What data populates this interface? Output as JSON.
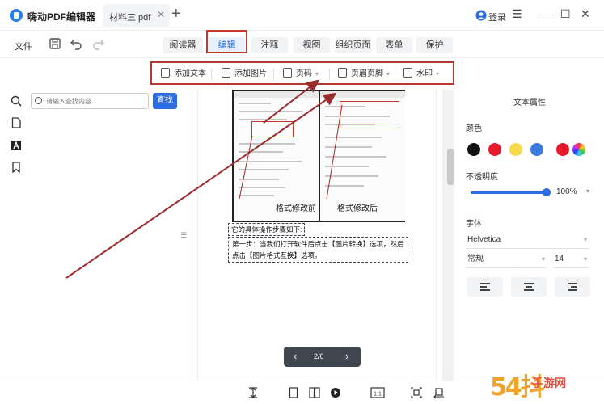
{
  "app": {
    "title": "嗨动PDF编辑器"
  },
  "document_tab": {
    "name": "材料三.pdf",
    "close": "✕",
    "new_tab": "+"
  },
  "account": {
    "login": "登录"
  },
  "window_controls": {
    "menu": "☰",
    "minimize": "—",
    "maximize": "☐",
    "close": "✕"
  },
  "menubar": {
    "file": "文件",
    "tabs": [
      {
        "label": "阅读器"
      },
      {
        "label": "编辑"
      },
      {
        "label": "注释"
      },
      {
        "label": "视图"
      },
      {
        "label": "组织页面"
      },
      {
        "label": "表单"
      },
      {
        "label": "保护"
      }
    ]
  },
  "edit_toolbar": {
    "items": [
      {
        "label": "添加文本",
        "icon": "edit-text-icon"
      },
      {
        "label": "添加图片",
        "icon": "add-image-icon"
      },
      {
        "label": "页码",
        "icon": "page-number-icon"
      },
      {
        "label": "页眉页脚",
        "icon": "header-footer-icon"
      },
      {
        "label": "水印",
        "icon": "watermark-icon"
      }
    ],
    "caret": "▾"
  },
  "search": {
    "placeholder": "请输入查找内容...",
    "button": "查找"
  },
  "document": {
    "caption_left": "格式修改前",
    "caption_right": "格式修改后",
    "paragraph_1": "它的具体操作步骤如下:",
    "paragraph_2": "第一步：当我们打开软件后点击【图片转换】选项，然后点击【图片格式互换】选项。"
  },
  "pager": {
    "current": "2/6",
    "prev": "‹",
    "next": "›"
  },
  "properties": {
    "title": "文本属性",
    "color_label": "颜色",
    "colors": [
      "#111111",
      "#e8192c",
      "#f7d94c",
      "#3a7be0",
      "#e8192c"
    ],
    "opacity_label": "不透明度",
    "opacity": "100%",
    "opacity_level": 1.0,
    "font_label": "字体",
    "font": "Helvetica",
    "style": "常规",
    "size": "14",
    "caret": "▾"
  },
  "watermark": {
    "brand": "54抖",
    "site": "手游网"
  }
}
